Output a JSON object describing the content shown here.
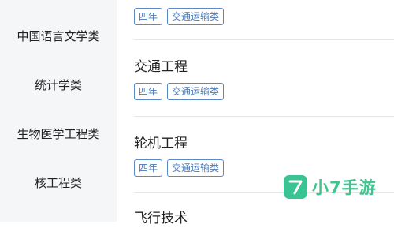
{
  "sidebar": {
    "items": [
      {
        "label": "中国语言文学类"
      },
      {
        "label": "统计学类"
      },
      {
        "label": "生物医学工程类"
      },
      {
        "label": "核工程类"
      }
    ]
  },
  "majors": [
    {
      "title": "",
      "tags": [
        "四年",
        "交通运输类"
      ]
    },
    {
      "title": "交通工程",
      "tags": [
        "四年",
        "交通运输类"
      ]
    },
    {
      "title": "轮机工程",
      "tags": [
        "四年",
        "交通运输类"
      ]
    },
    {
      "title": "飞行技术",
      "tags": []
    }
  ],
  "watermark": {
    "text": "小7手游",
    "color": "#2fbf85"
  },
  "colors": {
    "sidebar_bg": "#f5f6f8",
    "tag_border": "#5a88c8",
    "tag_text": "#4a7ab8"
  }
}
